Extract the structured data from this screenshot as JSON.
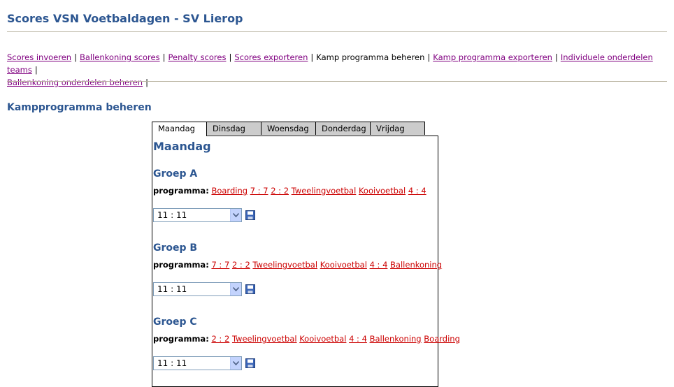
{
  "header": {
    "title": "Scores VSN Voetbaldagen - SV Lierop"
  },
  "nav": {
    "links": [
      "Scores invoeren",
      "Ballenkoning scores",
      "Penalty scores",
      "Scores exporteren",
      "Kamp programma beheren",
      "Kamp programma exporteren",
      "Individuele onderdelen teams",
      "Ballenkoning onderdelen beheren"
    ],
    "separator": "|"
  },
  "page": {
    "heading": "Kampprogramma beheren"
  },
  "tabs": [
    "Maandag",
    "Dinsdag",
    "Woensdag",
    "Donderdag",
    "Vrijdag"
  ],
  "panel": {
    "title": "Maandag",
    "program_label": "programma:",
    "groups": [
      {
        "name": "Groep A",
        "items": [
          "Boarding",
          "7 : 7",
          "2 : 2",
          "Tweelingvoetbal",
          "Kooivoetbal",
          "4 : 4"
        ],
        "selected_time": "11 : 11"
      },
      {
        "name": "Groep B",
        "items": [
          "7 : 7",
          "2 : 2",
          "Tweelingvoetbal",
          "Kooivoetbal",
          "4 : 4",
          "Ballenkoning"
        ],
        "selected_time": "11 : 11"
      },
      {
        "name": "Groep C",
        "items": [
          "2 : 2",
          "Tweelingvoetbal",
          "Kooivoetbal",
          "4 : 4",
          "Ballenkoning",
          "Boarding"
        ],
        "selected_time": "11 : 11"
      }
    ]
  },
  "colors": {
    "heading": "#2c5691",
    "visited_link": "#800080",
    "program_link": "#cc0000",
    "tab_inactive": "#cccccc"
  }
}
